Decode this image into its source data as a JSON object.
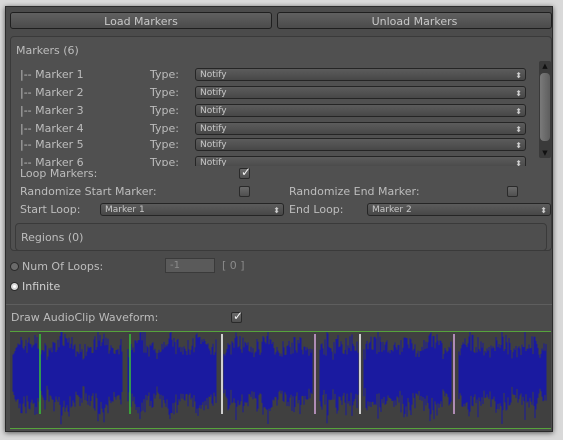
{
  "toolbar": {
    "load_label": "Load Markers",
    "unload_label": "Unload Markers"
  },
  "markers": {
    "header": "Markers (6)",
    "type_label": "Type:",
    "items": [
      {
        "label": "|-- Marker 1",
        "type": "Notify"
      },
      {
        "label": "|-- Marker 2",
        "type": "Notify"
      },
      {
        "label": "|-- Marker 3",
        "type": "Notify"
      },
      {
        "label": "|-- Marker 4",
        "type": "Notify"
      },
      {
        "label": "|-- Marker 5",
        "type": "Notify"
      },
      {
        "label": "|-- Marker 6",
        "type": "Notify"
      }
    ]
  },
  "loop": {
    "loop_markers_label": "Loop Markers:",
    "loop_markers_checked": true,
    "randomize_start_label": "Randomize Start Marker:",
    "randomize_start_checked": false,
    "randomize_end_label": "Randomize End Marker:",
    "randomize_end_checked": false,
    "start_loop_label": "Start Loop:",
    "start_loop_value": "Marker 1",
    "end_loop_label": "End Loop:",
    "end_loop_value": "Marker 2"
  },
  "regions": {
    "header": "Regions (0)"
  },
  "loops": {
    "num_label": "Num Of Loops:",
    "num_value": "-1",
    "bracket_value": "[ 0 ]",
    "infinite_label": "Infinite",
    "mode": "infinite"
  },
  "waveform": {
    "label": "Draw AudioClip Waveform:",
    "checked": true,
    "wave_color": "#1a1aa0",
    "marker_lines": [
      {
        "color": "#37c137"
      },
      {
        "color": "#37c137"
      },
      {
        "color": "#ffffff"
      },
      {
        "color": "#d4a6dc"
      },
      {
        "color": "#ffffff"
      },
      {
        "color": "#d4a6dc"
      }
    ]
  },
  "icons": {
    "check": "✓",
    "updown": "⬍",
    "up": "▲",
    "down": "▼"
  }
}
